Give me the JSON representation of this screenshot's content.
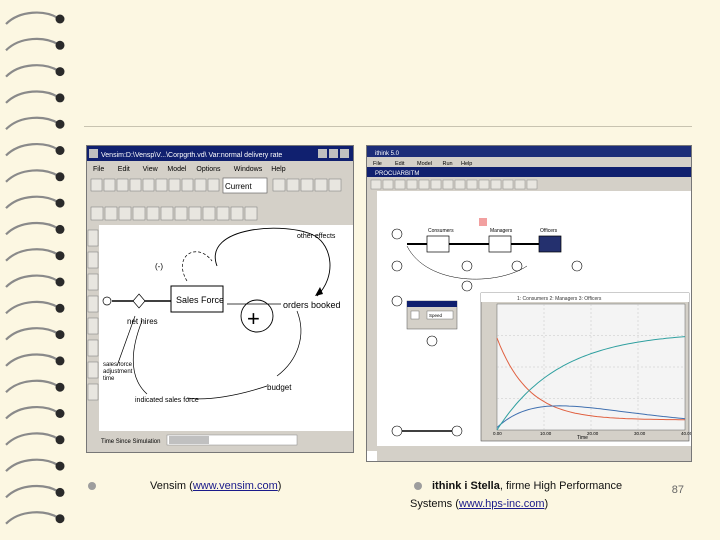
{
  "captions": {
    "left": {
      "name": "Vensim",
      "open": " (",
      "url": "www.vensim.com",
      "close": ")"
    },
    "right": {
      "name": "ithink i Stella",
      "rest": ", firme High Performance",
      "line2_pre": "Systems (",
      "url": "www.hps-inc.com",
      "close": ")"
    }
  },
  "page_number": "87",
  "vensim": {
    "title": "Vensim:D:\\Vensp\\V...\\Corpgrth.vd\\ Var:normal delivery rate",
    "menu": [
      "File",
      "Edit",
      "View",
      "Model",
      "Options",
      "Windows",
      "Help"
    ],
    "toolbar_select": "Current",
    "nodes": {
      "sales_force": "Sales Force",
      "orders_booked": "orders booked",
      "net_hires": "net hires",
      "budget": "budget",
      "sales_adjustment": "sales force adjustment time",
      "indicated_sales_force": "indicated sales force",
      "other_effects": "other effects"
    },
    "loop_negative": "(-)",
    "loop_positive": "+",
    "status": "Time Since Simulation"
  },
  "stella": {
    "title": "ithink 5.0",
    "doc_title": "PROCUARBITM",
    "menu": [
      "File",
      "Edit",
      "Model",
      "Run",
      "Help"
    ],
    "stocks": [
      "Consumers",
      "Managers",
      "Officers"
    ],
    "graph_title": "1: Consumers  2: Managers  3: Officers",
    "graph_select": "Speed",
    "axis_time": "Time",
    "axis_ticks": [
      "0.00",
      "10.00",
      "20.00",
      "30.00",
      "40.00"
    ]
  }
}
